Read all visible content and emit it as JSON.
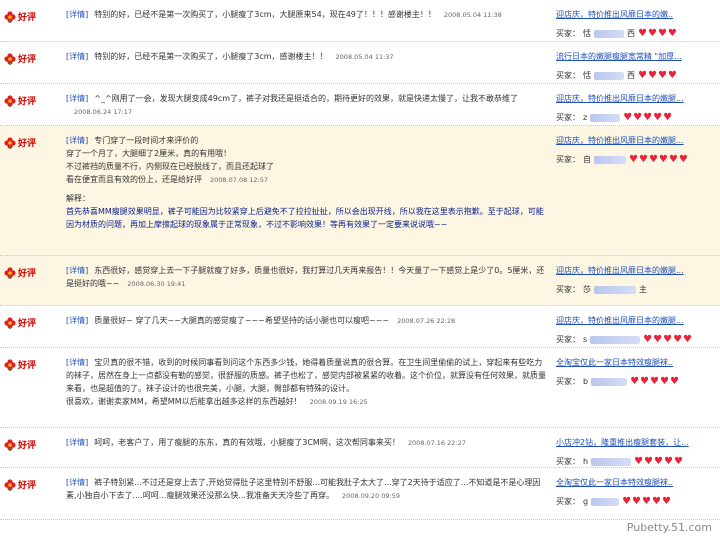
{
  "rating_label": "好评",
  "detail_tag": "[详情]",
  "buyer_prefix": "买家：",
  "reviews": [
    {
      "text": "特别的好，已经不是第一次购买了，小腿瘦了3cm，大腿原来54，现在49了！！！感谢楼主！！",
      "time": "2008.05.04 11:38",
      "reply": "迎店庆，特价推出风靡日本的嫩..",
      "buyer": "恬",
      "buyer_tail": "西",
      "hearts": 4
    },
    {
      "text": "特别的好，已经不是第一次购买了，小腿瘦了3cm，感谢楼主！！",
      "time": "2008.05.04 11:37",
      "reply": "流行日本的嫩腿瘦腿宽常精 \"加厚...",
      "buyer": "恬",
      "buyer_tail": "西",
      "hearts": 4
    },
    {
      "text": "^_^刚用了一会，发现大腿变成49cm了，裤子对我还是挺适合的，期待更好的效果，就是快递太慢了，让我不敢恭维了",
      "time": "2008.06.24 17:17",
      "reply": "迎店庆，特价推出风靡日本的嫩腿...",
      "buyer": "z",
      "buyer_tail": "",
      "hearts": 5
    },
    {
      "text": "专门穿了一段时间才来评价的\n穿了一个月了，大腿细了2厘米，真的有用哦！\n不过裤裆的质量不行，内侧现在已经脱线了，而且还起球了\n看在便宜而且有效的份上，还是给好评",
      "time": "2008.07.08 12:57",
      "explain_head": "解释：",
      "explain": "首先恭喜MM瘦腿效果明显，裤子可能因为比较紧穿上后避免不了拉拉扯扯，所以会出现开线，所以我在这里表示抱歉。至于起球，可能因为材质的问题，再加上摩擦起球的现象属于正常现象，不过不影响效果！等再有效果了一定要来说说哦~~",
      "reply": "迎店庆，特价推出风靡日本的嫩腿...",
      "buyer": "自",
      "buyer_tail": "",
      "hearts": 6
    },
    {
      "text": "东西很好，感觉穿上去一下子腿就瘦了好多，质量也很好，我打算过几天再来报告！！今天量了一下感觉上是少了0。5厘米，还是挺好的哦~~",
      "time": "2008.06.30 19:41",
      "reply": "迎店庆，特价推出风靡日本的嫩腿...",
      "buyer": "莎",
      "buyer_tail": "主",
      "hearts": 0
    },
    {
      "text": "质量很好~ 穿了几天~~大腿真的感觉瘦了~~~希望坚持的话小腿也可以瘦吧~~~",
      "time": "2008.07.26 22:28",
      "reply": "迎店庆，特价推出风靡日本的嫩腿...",
      "buyer": "s",
      "buyer_tail": "",
      "hearts": 5
    },
    {
      "text": "宝贝真的很不错，收到的时候同事看到问这个东西多少钱，她得着质量说真的很合算。在卫生间里偷偷的试上，穿起来有些吃力的袜子，居然在身上一点都没有勒的感觉，很舒服的质感。裤子也松了，感觉内部被紧紧的收着。这个价位，就算没有任何效果，就质量来看，也是超值的了。袜子设计的也很完美，小腿，大腿，臀部都有特殊的设计。\n很喜欢，谢谢卖家MM，希望MM以后能拿出越多这样的东西越好！",
      "time": "2008.09.19 16:25",
      "reply": "全淘宝仅此一家日本特效瘦腿袜..",
      "buyer": "b",
      "buyer_tail": "",
      "hearts": 5
    },
    {
      "text": "呵呵，老客户了，用了瘦腿的东东，真的有效哦，小腿瘦了3CM啊，这次帮同事来买！",
      "time": "2008.07.16 22:27",
      "reply": "小店冲2钻，隆重推出瘦腿套装，让...",
      "buyer": "h",
      "buyer_tail": "",
      "hearts": 5
    },
    {
      "text": "裤子特别紧...不过还是穿上去了,开始觉得肚子这里特别不舒服...可能我肚子太大了...穿了2天待于适应了...不知道是不是心理因素,小独自小下去了....呵呵...瘦腿效果还没那么快...我准备天天冷些了再穿。",
      "time": "2008.09.20 09:59",
      "reply": "全淘宝仅此一家日本特效瘦腿袜..",
      "buyer": "g",
      "buyer_tail": "",
      "hearts": 5
    }
  ],
  "watermark": "Pubetty.51.com",
  "colors": {
    "rating": "#d40000",
    "link": "#1f4fb8",
    "explain": "#0a1f8c",
    "heart": "#e8233a",
    "alt_bg": "#fdf6e3"
  }
}
